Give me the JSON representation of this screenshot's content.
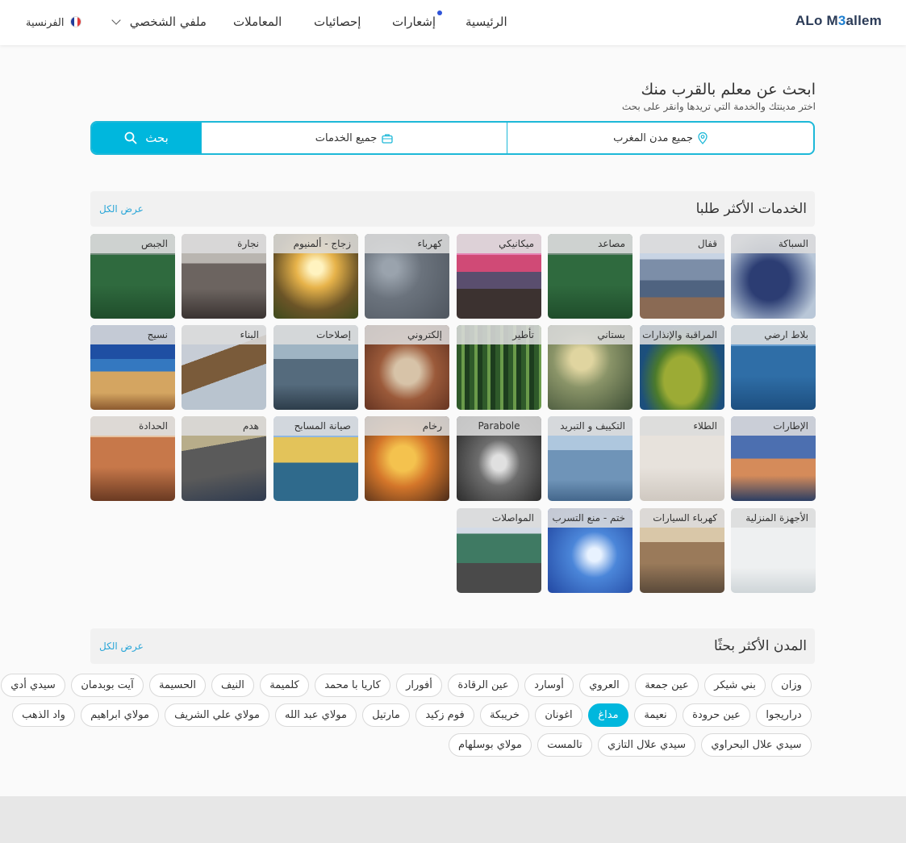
{
  "header": {
    "logo": {
      "part1": "ALo M",
      "part2": "3",
      "part3": "allem"
    },
    "nav": {
      "home": "الرئيسية",
      "notifications": "إشعارات",
      "stats": "إحصائيات",
      "transactions": "المعاملات",
      "profile": "ملفي الشخصي",
      "language": "الفرنسية"
    }
  },
  "search": {
    "title": "ابحث عن معلم بالقرب منك",
    "subtitle": "اختر مدينتك والخدمة التي تريدها وانقر على بحث",
    "city_placeholder": "جميع مدن المغرب",
    "service_placeholder": "جميع الخدمات",
    "button": "بحث"
  },
  "services_section": {
    "title": "الخدمات الأكثر طلبا",
    "view_all": "عرض الكل",
    "items": [
      {
        "label": "السباكة",
        "icon": "photo-berries"
      },
      {
        "label": "قفال",
        "icon": "photo-city-pier"
      },
      {
        "label": "مصاعد",
        "icon": "photo-green-field"
      },
      {
        "label": "ميكانيكي",
        "icon": "photo-sunset-pier"
      },
      {
        "label": "كهرباء",
        "icon": "photo-raindrops"
      },
      {
        "label": "زجاج - ألمنيوم",
        "icon": "photo-meadow-sunset"
      },
      {
        "label": "نجارة",
        "icon": "photo-bridge"
      },
      {
        "label": "الجبص",
        "icon": "photo-green-field"
      },
      {
        "label": "بلاط ارضي",
        "icon": "photo-ocean"
      },
      {
        "label": "المراقبة والإنذارات",
        "icon": "photo-island"
      },
      {
        "label": "بستاني",
        "icon": "photo-forest-bokeh"
      },
      {
        "label": "تأطير",
        "icon": "photo-bamboo"
      },
      {
        "label": "إلكتروني",
        "icon": "photo-cups"
      },
      {
        "label": "إصلاحات",
        "icon": "photo-man-lake"
      },
      {
        "label": "البناء",
        "icon": "photo-eagle"
      },
      {
        "label": "نسيج",
        "icon": "photo-coast"
      },
      {
        "label": "الإطارات",
        "icon": "photo-harbor"
      },
      {
        "label": "الطلاء",
        "icon": "photo-fog"
      },
      {
        "label": "التكييف و التبريد",
        "icon": "photo-clouds"
      },
      {
        "label": "Parabole",
        "icon": "photo-tree-tunnel"
      },
      {
        "label": "رخام",
        "icon": "photo-autumn-leaves"
      },
      {
        "label": "صيانة المسابح",
        "icon": "photo-canal"
      },
      {
        "label": "هدم",
        "icon": "photo-mountain"
      },
      {
        "label": "الحدادة",
        "icon": "photo-dunes"
      },
      {
        "label": "الأجهزة المنزلية",
        "icon": "photo-white-sea"
      },
      {
        "label": "كهرباء السيارات",
        "icon": "photo-bike"
      },
      {
        "label": "ختم - منع التسرب",
        "icon": "photo-blue-light"
      },
      {
        "label": "المواصلات",
        "icon": "photo-road"
      }
    ]
  },
  "cities_section": {
    "title": "المدن الأكثر بحثًا",
    "view_all": "عرض الكل",
    "rows": [
      [
        "وزان",
        "بني شيكر",
        "عين جمعة",
        "العروي",
        "أوسارد",
        "عين الرقادة",
        "أفورار",
        "كاريا با محمد",
        "كلميمة",
        "النيف",
        "الحسيمة",
        "آيت بوبدمان",
        "سيدي أدي"
      ],
      [
        "دراريجوا",
        "عين حرودة",
        "نعيمة",
        "مداغ",
        "اغونان",
        "خريبكة",
        "فوم زكيد",
        "مارتيل",
        "مولاي عبد الله",
        "مولاي علي الشريف",
        "مولاي ابراهيم",
        "واد الذهب"
      ],
      [
        "سيدي علال البحراوي",
        "سيدي علال التازي",
        "تالمست",
        "مولاي بوسلهام"
      ]
    ],
    "active": "مداغ"
  },
  "colors": {
    "accent": "#00b7dd",
    "link": "#2aa6d8",
    "notification_dot": "#2f54d9"
  }
}
